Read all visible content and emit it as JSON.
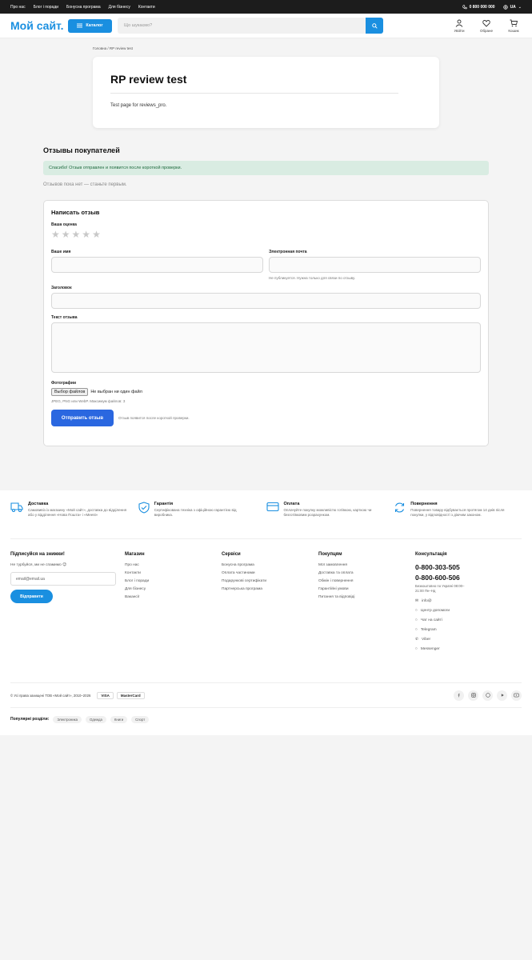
{
  "topbar": {
    "links": [
      "Про нас",
      "Блог і поради",
      "Бонусна програма",
      "Для бізнесу",
      "Контакти"
    ],
    "phone": "0 800 000 000",
    "lang": "UA"
  },
  "header": {
    "logo": "Мой сайт.",
    "catalog": "Каталог",
    "search_placeholder": "Що шукаємо?",
    "actions": [
      {
        "label": "Увійти",
        "icon": "user-icon"
      },
      {
        "label": "Обране",
        "icon": "heart-icon"
      },
      {
        "label": "Кошик",
        "icon": "cart-icon"
      }
    ]
  },
  "breadcrumb": {
    "home": "Головна",
    "sep": "/",
    "current": "RP review test"
  },
  "page": {
    "title": "RP review test",
    "body": "Test page for reviews_pro."
  },
  "reviews": {
    "heading": "Отзывы покупателей",
    "alert": "Спасибо! Отзыв отправлен и появится после короткой проверки.",
    "empty": "Отзывов пока нет — станьте первым.",
    "form": {
      "title": "Написать отзыв",
      "rating_label": "Ваша оценка",
      "rating_value": 0,
      "name_label": "Ваше имя",
      "email_label": "Электронная почта",
      "email_hint": "Не публикуется. Нужна только для связи по отзыву.",
      "subject_label": "Заголовок",
      "text_label": "Текст отзыва",
      "photos_label": "Фотографии",
      "file_button": "Выбор файлов",
      "file_status": "Не выбран ни один файл",
      "photos_hint": "JPEG, PNG или WebP. Максимум файлов: 3",
      "submit": "Отправить отзыв",
      "submit_note": "Отзыв появится после короткой проверки."
    }
  },
  "footer": {
    "benefits": [
      {
        "title": "Доставка",
        "text": "Самовивіз із магазину «Мой сайт», доставка до відділення або у відділення «Нова Пошта» і «Meest»",
        "icon": "truck-icon"
      },
      {
        "title": "Гарантія",
        "text": "Сертифікована техніка з офіційною гарантією від виробника.",
        "icon": "shield-check-icon"
      },
      {
        "title": "Оплата",
        "text": "Оплачуйте покупку можливістю готівкою, карткою чи безготівковим розрахунком.",
        "icon": "card-icon"
      },
      {
        "title": "Повернення",
        "text": "Повернення товару відбувається протягом 14 днів після покупки, у відповідності з діючим законом.",
        "icon": "refresh-icon"
      }
    ],
    "subscribe": {
      "title": "Підписуйся на знижки!",
      "note": "Не турбуйся, ми не спамимо 😉",
      "placeholder": "email@email.ua",
      "button": "Відправити"
    },
    "columns": [
      {
        "title": "Магазин",
        "items": [
          "Про нас",
          "Контакти",
          "Блог і поради",
          "Для бізнесу",
          "Вакансії"
        ]
      },
      {
        "title": "Сервіси",
        "items": [
          "Бонусна програма",
          "Оплата частинами",
          "Подарункові сертифікати",
          "Партнерська програма"
        ]
      },
      {
        "title": "Покупцям",
        "items": [
          "Мої замовлення",
          "Доставка та оплата",
          "Обмін і повернення",
          "Гарантійні умови",
          "Питання та відповіді"
        ]
      }
    ],
    "consult": {
      "title": "Консультація",
      "phone1": "0-800-303-505",
      "phone2": "0-800-600-506",
      "schedule": "Безкоштовно по Україні 08:00–21:00 Пн–Нд",
      "contacts": [
        {
          "label": "info@",
          "icon": "mail-icon"
        },
        {
          "label": "Центр допомоги",
          "icon": "chat-icon"
        },
        {
          "label": "Чат на сайті",
          "icon": "chat-icon"
        },
        {
          "label": "Telegram",
          "icon": "chat-icon"
        },
        {
          "label": "Viber",
          "icon": "phone-icon"
        },
        {
          "label": "Messenger",
          "icon": "chat-icon"
        }
      ]
    },
    "copyright": "© Усі права захищені ТОВ «Мой сайт», 2010–2026",
    "payments": [
      "VISA",
      "MasterCard"
    ],
    "popular_label": "Популярні розділи:",
    "popular": [
      "Электроника",
      "Одежда",
      "Книги",
      "Спорт"
    ],
    "colors": {
      "accent": "#1a8fe0",
      "submit": "#2a67e0",
      "alert_bg": "#d9ece2"
    }
  }
}
